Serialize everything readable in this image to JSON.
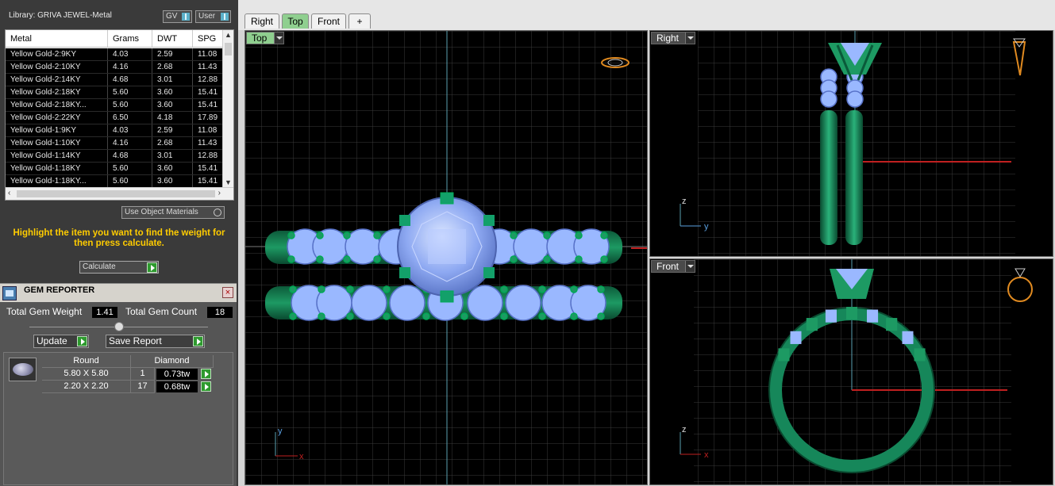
{
  "library": {
    "label": "Library: GRIVA JEWEL-Metal",
    "toggle_gv": "GV",
    "toggle_user": "User"
  },
  "metal_table": {
    "headers": [
      "Metal",
      "Grams",
      "DWT",
      "SPG"
    ],
    "rows": [
      [
        "Yellow Gold-2:9KY",
        "4.03",
        "2.59",
        "11.08"
      ],
      [
        "Yellow Gold-2:10KY",
        "4.16",
        "2.68",
        "11.43"
      ],
      [
        "Yellow Gold-2:14KY",
        "4.68",
        "3.01",
        "12.88"
      ],
      [
        "Yellow Gold-2:18KY",
        "5.60",
        "3.60",
        "15.41"
      ],
      [
        "Yellow Gold-2:18KY...",
        "5.60",
        "3.60",
        "15.41"
      ],
      [
        "Yellow Gold-2:22KY",
        "6.50",
        "4.18",
        "17.89"
      ],
      [
        "Yellow Gold-1:9KY",
        "4.03",
        "2.59",
        "11.08"
      ],
      [
        "Yellow Gold-1:10KY",
        "4.16",
        "2.68",
        "11.43"
      ],
      [
        "Yellow Gold-1:14KY",
        "4.68",
        "3.01",
        "12.88"
      ],
      [
        "Yellow Gold-1:18KY",
        "5.60",
        "3.60",
        "15.41"
      ],
      [
        "Yellow Gold-1:18KY...",
        "5.60",
        "3.60",
        "15.41"
      ]
    ]
  },
  "use_object_materials": "Use Object Materials",
  "hint": "Highlight the item you want to find the weight for then press calculate.",
  "calculate": "Calculate",
  "gem_reporter": {
    "title": "GEM REPORTER",
    "total_weight_label": "Total Gem Weight",
    "total_weight": "1.41",
    "total_count_label": "Total Gem Count",
    "total_count": "18",
    "update": "Update",
    "save_report": "Save Report",
    "shape": "Round",
    "type": "Diamond",
    "gems": [
      {
        "size": "5.80 X 5.80",
        "count": "1",
        "weight": "0.73tw"
      },
      {
        "size": "2.20 X 2.20",
        "count": "17",
        "weight": "0.68tw"
      }
    ]
  },
  "tabs": [
    "Right",
    "Top",
    "Front",
    "+"
  ],
  "viewports": {
    "top": "Top",
    "right": "Right",
    "front": "Front",
    "axis_y": "y",
    "axis_x": "x",
    "axis_z": "z"
  },
  "colors": {
    "ring_metal": "#1e8f5e",
    "gem": "#9ab8ff",
    "grid": "#3c3c3c",
    "accent_yellow": "#ffcc00"
  }
}
